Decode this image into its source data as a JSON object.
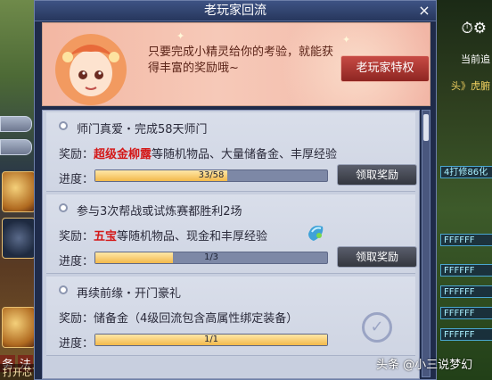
{
  "window": {
    "title": "老玩家回流",
    "close_label": "×"
  },
  "banner": {
    "text": "只要完成小精灵给你的考验，就能获得丰富的奖励哦~",
    "button_label": "老玩家特权"
  },
  "tasks": [
    {
      "title": "师门真爱・完成58天师门",
      "reward_prefix": "奖励：",
      "reward_highlight": "超级金柳露",
      "reward_rest": "等随机物品、大量储备金、丰厚经验",
      "progress_label": "进度：",
      "progress_text": "33/58",
      "progress_fraction": 0.569,
      "button_label": "领取奖励"
    },
    {
      "title": "参与3次帮战或试炼赛都胜利2场",
      "reward_prefix": "奖励：",
      "reward_highlight": "五宝",
      "reward_rest": "等随机物品、现金和丰厚经验",
      "progress_label": "进度：",
      "progress_text": "1/3",
      "progress_fraction": 0.333,
      "button_label": "领取奖励"
    },
    {
      "title": "再续前缘・开门豪礼",
      "reward_prefix": "奖励：",
      "reward_highlight": "",
      "reward_rest": "储备金（4级回流包含高属性绑定装备）",
      "progress_label": "进度：",
      "progress_text": "1/1",
      "progress_fraction": 1.0,
      "completed": true
    }
  ],
  "background": {
    "left_bottom_text": "打开芯下增加某曲",
    "right_top_text": "当前追",
    "right_sub_text": "头》虎腑",
    "right_tags": [
      "4打修86化",
      "FFFFFF",
      "FFFFFF",
      "FFFFFF",
      "FFFFFF",
      "FFFFFF"
    ],
    "left_bottom_labels": [
      "务",
      "法"
    ]
  },
  "watermark": "头条 @小三说梦幻",
  "colors": {
    "accent_red": "#d41818",
    "progress_fill": "#f3b94a",
    "title_bar": "#2f426d"
  }
}
